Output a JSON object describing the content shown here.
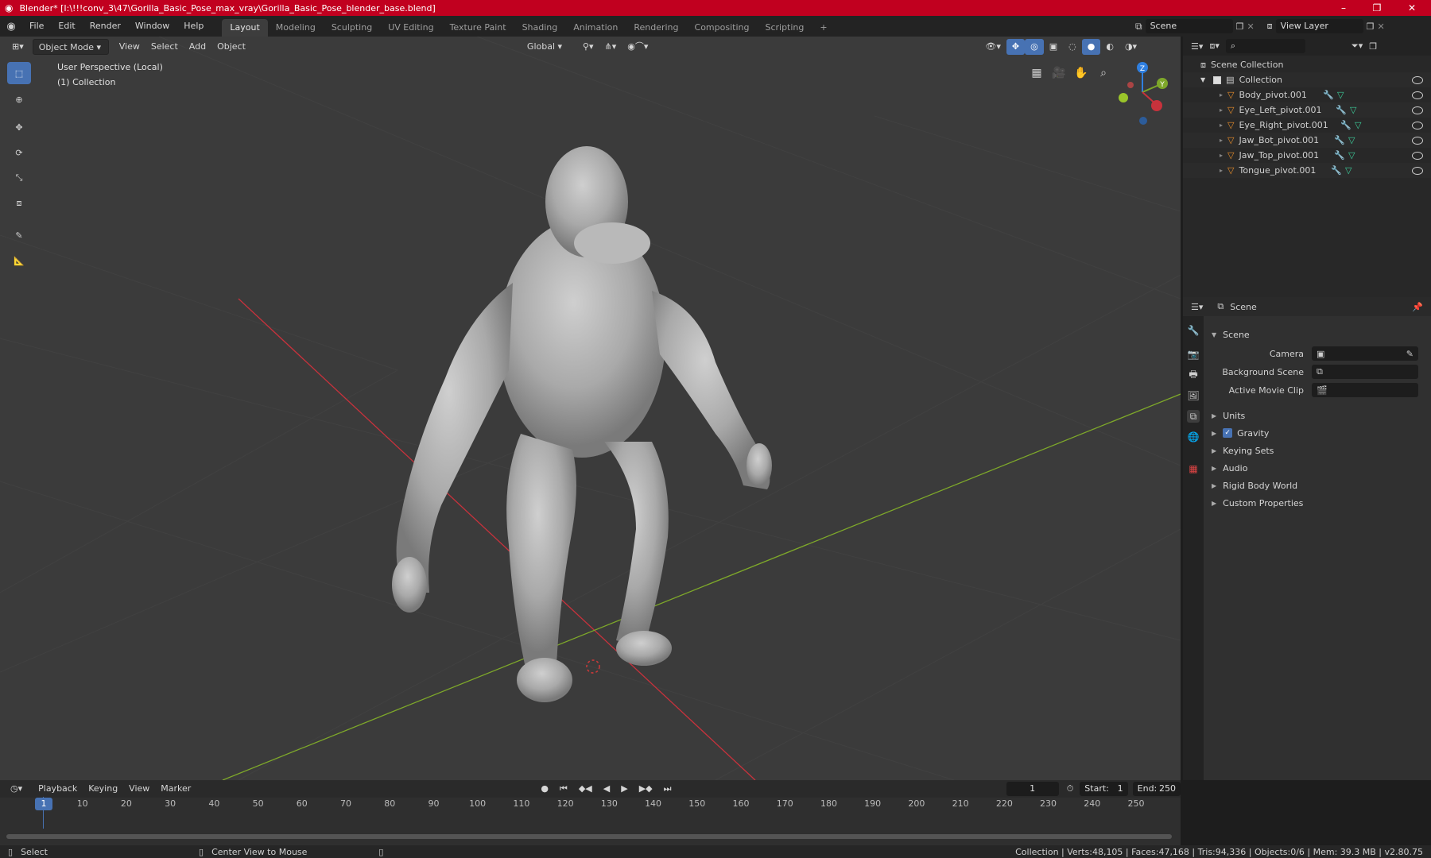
{
  "window": {
    "title": "Blender* [I:\\!!!conv_3\\47\\Gorilla_Basic_Pose_max_vray\\Gorilla_Basic_Pose_blender_base.blend]",
    "minimize": "–",
    "maximize": "❐",
    "close": "✕"
  },
  "menu": [
    "File",
    "Edit",
    "Render",
    "Window",
    "Help"
  ],
  "workspaces": [
    "Layout",
    "Modeling",
    "Sculpting",
    "UV Editing",
    "Texture Paint",
    "Shading",
    "Animation",
    "Rendering",
    "Compositing",
    "Scripting"
  ],
  "add_workspace": "+",
  "scene_field": "Scene",
  "viewlayer_field": "View Layer",
  "viewport": {
    "mode": "Object Mode",
    "menus": [
      "View",
      "Select",
      "Add",
      "Object"
    ],
    "transform_orientation": "Global",
    "overlay_line1": "User Perspective (Local)",
    "overlay_line2": "(1) Collection",
    "gizmo": {
      "z": "Z",
      "y": "Y"
    }
  },
  "outliner": {
    "search_placeholder": "",
    "scene_collection": "Scene Collection",
    "collection": "Collection",
    "items": [
      "Body_pivot.001",
      "Eye_Left_pivot.001",
      "Eye_Right_pivot.001",
      "Jaw_Bot_pivot.001",
      "Jaw_Top_pivot.001",
      "Tongue_pivot.001"
    ]
  },
  "properties": {
    "header": "Scene",
    "section": "Scene",
    "camera_label": "Camera",
    "background_label": "Background Scene",
    "movieclip_label": "Active Movie Clip",
    "panels": [
      "Units",
      "Gravity",
      "Keying Sets",
      "Audio",
      "Rigid Body World",
      "Custom Properties"
    ],
    "gravity_checked": true
  },
  "timeline": {
    "menus": [
      "Playback",
      "Keying",
      "View",
      "Marker"
    ],
    "current_frame": "1",
    "start_label": "Start:",
    "start": "1",
    "end_label": "End:",
    "end": "250",
    "ticks": [
      "1",
      "10",
      "20",
      "30",
      "40",
      "50",
      "60",
      "70",
      "80",
      "90",
      "100",
      "110",
      "120",
      "130",
      "140",
      "150",
      "160",
      "170",
      "180",
      "190",
      "200",
      "210",
      "220",
      "230",
      "240",
      "250"
    ]
  },
  "status": {
    "left1": "Select",
    "left2": "Center View to Mouse",
    "right": "Collection | Verts:48,105 | Faces:47,168 | Tris:94,336 | Objects:0/6 | Mem: 39.3 MB | v2.80.75"
  },
  "colors": {
    "title_bar": "#c1001f",
    "active_tool": "#4772b3",
    "x_axis": "#c8323c",
    "y_axis": "#7ea82a",
    "z_axis": "#2f7fe0"
  }
}
